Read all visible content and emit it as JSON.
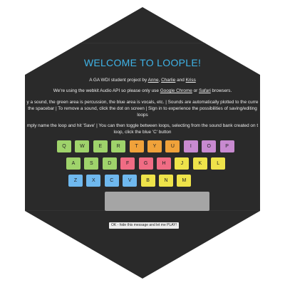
{
  "title": "WELCOME TO LOOPLE!",
  "intro": {
    "prefix": "A GA WDI student project by ",
    "name1": "Anne",
    "sep1": ", ",
    "name2": "Charlie",
    "sep2": " and ",
    "name3": "Kriss"
  },
  "browser_note": {
    "prefix": "We're using the webkit Audio API so please only use ",
    "link1": "Google Chrome",
    "mid": " or ",
    "link2": "Safari",
    "suffix": " browsers."
  },
  "instructions_1_line1": "y a sound, the green area is percussion, the blue area is vocals, etc. | Sounds are automatically plotted to the curre",
  "instructions_1_line2": "the spacebar | To remove a sound, click the dot on screen | Sign in to experience the possibilities of saving/editing",
  "instructions_1_line3": "loops",
  "instructions_2_line1": "mply name the loop and hit 'Save' | You can then toggle between loops, selecting from the sound bank created on t",
  "instructions_2_line2": "loop, click the blue 'C' button",
  "keyboard": {
    "row1": [
      {
        "label": "Q",
        "color": "#9fd36b"
      },
      {
        "label": "W",
        "color": "#9fd36b"
      },
      {
        "label": "E",
        "color": "#9fd36b"
      },
      {
        "label": "R",
        "color": "#9fd36b"
      },
      {
        "label": "T",
        "color": "#f0a23a"
      },
      {
        "label": "Y",
        "color": "#f0a23a"
      },
      {
        "label": "U",
        "color": "#f0a23a"
      },
      {
        "label": "I",
        "color": "#c88ad0"
      },
      {
        "label": "O",
        "color": "#c88ad0"
      },
      {
        "label": "P",
        "color": "#c88ad0"
      }
    ],
    "row2": [
      {
        "label": "A",
        "color": "#9fd36b"
      },
      {
        "label": "S",
        "color": "#9fd36b"
      },
      {
        "label": "D",
        "color": "#9fd36b"
      },
      {
        "label": "F",
        "color": "#f06c84"
      },
      {
        "label": "G",
        "color": "#f06c84"
      },
      {
        "label": "H",
        "color": "#f06c84"
      },
      {
        "label": "J",
        "color": "#eee34a"
      },
      {
        "label": "K",
        "color": "#eee34a"
      },
      {
        "label": "L",
        "color": "#eee34a"
      }
    ],
    "row3": [
      {
        "label": "Z",
        "color": "#6fb8ee"
      },
      {
        "label": "X",
        "color": "#6fb8ee"
      },
      {
        "label": "C",
        "color": "#6fb8ee"
      },
      {
        "label": "V",
        "color": "#6fb8ee"
      },
      {
        "label": "B",
        "color": "#eee34a"
      },
      {
        "label": "N",
        "color": "#eee34a"
      },
      {
        "label": "M",
        "color": "#eee34a"
      }
    ]
  },
  "ok_button": "OK - hide this message and let me PLAY!"
}
